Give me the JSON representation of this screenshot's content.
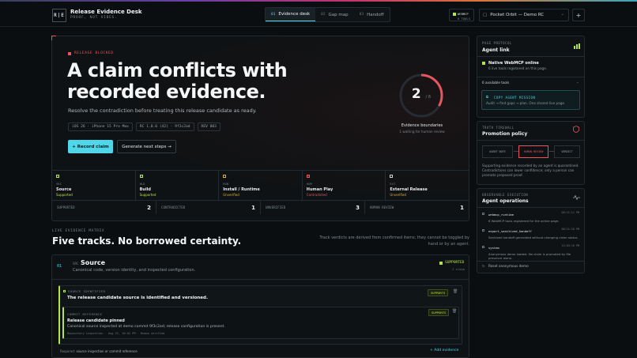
{
  "app": {
    "logo": "R|E",
    "title": "Release Evidence Desk",
    "subtitle": "PROOF, NOT VIBES."
  },
  "tabs": [
    {
      "num": "01",
      "label": "Evidence desk"
    },
    {
      "num": "02",
      "label": "Gap map"
    },
    {
      "num": "03",
      "label": "Handoff"
    }
  ],
  "mcp": {
    "line1": "WEBMCP",
    "line2": "6 TOOLS"
  },
  "project": {
    "icon": "▢",
    "label": "Pocket Orbit — Demo RC",
    "chevron": "⌄"
  },
  "add_button": "+",
  "hero": {
    "status": "RELEASE BLOCKED",
    "headline": "A claim conflicts with recorded evidence.",
    "subline": "Resolve the contradiction before treating this release candidate as ready.",
    "chips": [
      "iOS 26 · iPhone 15 Pro Max",
      "RC 1.0.0 (42) · 9f3c2ad",
      "REV 003"
    ],
    "primary_button": "+  Record claim",
    "secondary_button": "Generate next steps  →",
    "ring": {
      "value": "2",
      "of": "/ 6",
      "fraction": 0.333,
      "label": "Evidence boundaries",
      "sub": "1 waiting for human review"
    }
  },
  "tracks": [
    {
      "code": "SRC",
      "name": "Source",
      "status": "Supported",
      "color": "#b6e34a"
    },
    {
      "code": "BLD",
      "name": "Build",
      "status": "Supported",
      "color": "#b6e34a"
    },
    {
      "code": "RUN",
      "name": "Install / Runtime",
      "status": "Unverified",
      "color": "#e0b23a"
    },
    {
      "code": "HUM",
      "name": "Human Play",
      "status": "Contradicted",
      "color": "#e8555f"
    },
    {
      "code": "EXT",
      "name": "External Release",
      "status": "Unverified",
      "color": "#cfd3d6"
    }
  ],
  "summary": [
    {
      "label": "SUPPORTED",
      "value": "2"
    },
    {
      "label": "CONTRADICTED",
      "value": "1"
    },
    {
      "label": "UNVERIFIED",
      "value": "3"
    },
    {
      "label": "HUMAN REVIEW",
      "value": "1"
    }
  ],
  "matrix": {
    "tag": "LIVE EVIDENCE MATRIX",
    "title": "Five tracks. No borrowed certainty.",
    "note": "Track verdicts are derived from confirmed items; they cannot be toggled by hand or by an agent."
  },
  "source_track": {
    "num": "01",
    "code": "SRC",
    "title": "Source",
    "subtitle": "Canonical code, version identity, and inspected configuration.",
    "badge": "SUPPORTED",
    "count": "1 claim",
    "claim": {
      "label": "SOURCE IDENTIFIED",
      "title": "The release candidate source is identified and versioned.",
      "pill": "SUPPORTS",
      "receipt": {
        "label": "COMMIT REFERENCE",
        "title": "Release candidate pinned",
        "body": "Canonical source inspected at demo commit 9f3c2ad; release configuration is present.",
        "meta": "Repository inspection · Aug 21, 10:02 PM · Human verified",
        "pill": "SUPPORTS"
      }
    },
    "required_label": "Required:",
    "required_value": "source inspection or commit reference",
    "add_evidence": "+  Add evidence"
  },
  "sidebar": {
    "protocol": {
      "tag": "PAGE PROTOCOL",
      "title": "Agent link",
      "online_title": "Native WebMCP online",
      "online_sub": "6 live tools registered on this page.",
      "tools_label": "6 available tools",
      "copy_label": "COPY AGENT MISSION",
      "copy_sub": "Audit → find gaps → plan. One shared live page."
    },
    "truth": {
      "tag": "TRUTH FIREWALL",
      "title": "Promotion policy",
      "flow": [
        "AGENT NOTE",
        "HUMAN REVIEW",
        "VERDICT"
      ],
      "text": "Supporting evidence recorded by an agent is quarantined. Contradictions can lower confidence; only a person can promote proposed proof."
    },
    "ops": {
      "tag": "OBSERVABLE EXECUTION",
      "title": "Agent operations",
      "items": [
        {
          "name": "webmcp_runtime",
          "time": "08:21:11 PM",
          "desc": "6 WebMCP tools registered for the active page."
        },
        {
          "name": "export_sanitized_handoff",
          "time": "08:21:18 PM",
          "desc": "Sanitized handoff generated without changing claim status."
        },
        {
          "name": "system",
          "time": "12:03:10 PM",
          "desc": "Anonymous demo loaded. No claim is promoted by file presence alone."
        }
      ],
      "reset": "Reset anonymous demo"
    }
  },
  "colors": {
    "accent": "#4fd6e8",
    "supported": "#b6e34a",
    "contradicted": "#e8555f",
    "unverified": "#e0b23a"
  }
}
